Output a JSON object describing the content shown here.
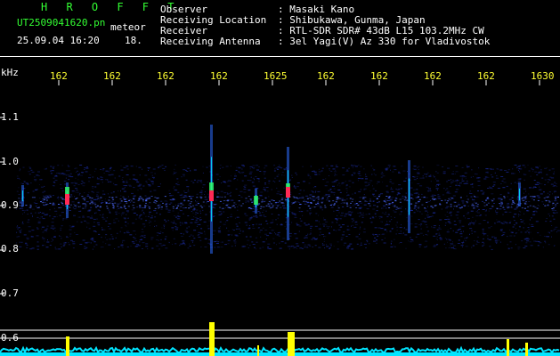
{
  "header": {
    "station": "H R O F F T",
    "filename": "UT2509041620.pn",
    "mode": "meteor",
    "datetime": "25.09.04 16:20",
    "count": "18.",
    "fields": [
      {
        "label": "Observer",
        "value": ": Masaki Kano"
      },
      {
        "label": "Receiving Location",
        "value": ": Shibukawa, Gunma, Japan"
      },
      {
        "label": "Receiver",
        "value": ": RTL-SDR SDR# 43dB L15 103.2MHz CW"
      },
      {
        "label": "Receiving Antenna",
        "value": ": 3el Yagi(V) Az 330 for Vladivostok"
      }
    ]
  },
  "y_axis": {
    "unit": "kHz",
    "ticks": [
      "1.1",
      "1.0",
      "0.9",
      "0.8",
      "0.7",
      "0.6"
    ]
  },
  "x_axis": {
    "ticks": [
      "162",
      "162",
      "162",
      "162",
      "1625",
      "162",
      "162",
      "162",
      "162",
      "1630"
    ]
  },
  "colors": {
    "background": "#000000",
    "noise": "#1a2a9a",
    "trace": "#00e5ff",
    "highlight": "#ffff00",
    "signal_hot": "#ff2a55",
    "grid": "#ffffff"
  }
}
